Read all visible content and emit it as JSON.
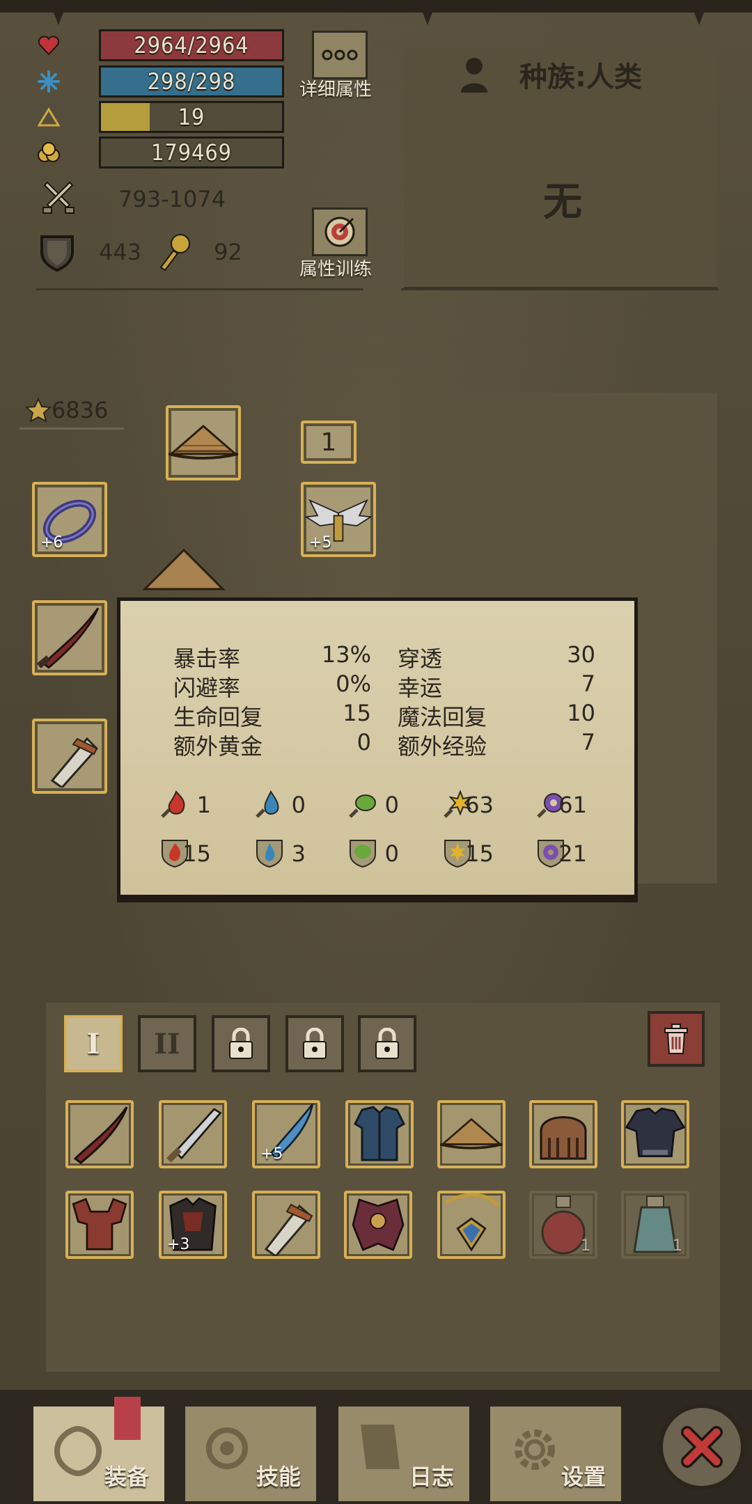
{
  "stats": {
    "hp": {
      "text": "2964/2964",
      "fraction": 1.0,
      "color": "#8d3a3e"
    },
    "mp": {
      "text": "298/298",
      "fraction": 1.0,
      "color": "#356f8c"
    },
    "level": {
      "text": "19",
      "fraction": 0.27,
      "color": "#b59c3d"
    },
    "gold": {
      "text": "179469",
      "fraction": 0.0,
      "color": "#524c3a"
    },
    "attack": "793-1074",
    "armor": "443",
    "magic_resist": "92"
  },
  "buttons": {
    "detail_label": "详细属性",
    "train_label": "属性训练"
  },
  "race": {
    "label": "种族:人类",
    "value": "无"
  },
  "equipment": {
    "score": "6836",
    "badge_count": "1",
    "ring_plus": "+6",
    "amulet_plus": "+5"
  },
  "tooltip": {
    "left": [
      {
        "label": "暴击率",
        "value": "13%"
      },
      {
        "label": "闪避率",
        "value": "0%"
      },
      {
        "label": "生命回复",
        "value": "15"
      },
      {
        "label": "额外黄金",
        "value": "0"
      }
    ],
    "right": [
      {
        "label": "穿透",
        "value": "30"
      },
      {
        "label": "幸运",
        "value": "7"
      },
      {
        "label": "魔法回复",
        "value": "10"
      },
      {
        "label": "额外经验",
        "value": "7"
      }
    ],
    "attack_elements": [
      "1",
      "0",
      "0",
      "63",
      "61"
    ],
    "defense_elements": [
      "15",
      "3",
      "0",
      "15",
      "21"
    ]
  },
  "inventory": {
    "tabs": [
      "I",
      "II"
    ],
    "row1_plus": [
      "",
      "",
      "+5",
      "",
      "",
      "",
      ""
    ],
    "row2_plus": [
      "",
      "+3",
      "",
      "",
      "",
      "1",
      "1"
    ]
  },
  "nav": {
    "equip": "装备",
    "skills": "技能",
    "log": "日志",
    "settings": "设置"
  },
  "colors": {
    "slot_border": "#d7b158",
    "fire": "#c9362c",
    "water": "#3a86b8",
    "nature": "#6aa83c",
    "light": "#e0b32a",
    "arcane": "#7b4fb0"
  }
}
